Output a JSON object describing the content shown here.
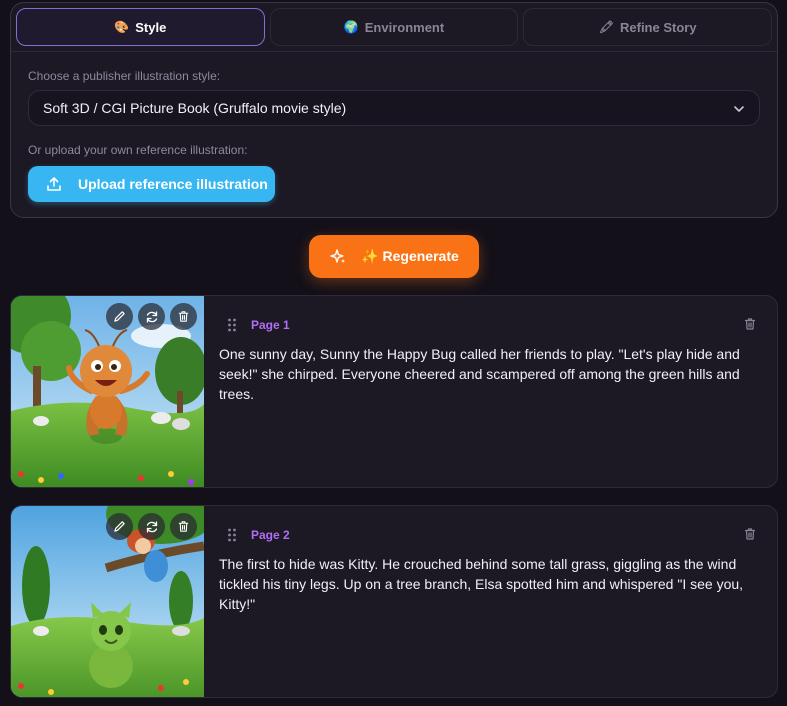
{
  "tabs": [
    {
      "label": "Style",
      "icon": "palette-icon",
      "emoji": "🎨",
      "active": true
    },
    {
      "label": "Environment",
      "icon": "globe-icon",
      "emoji": "🌍",
      "active": false
    },
    {
      "label": "Refine Story",
      "icon": "pencil-icon",
      "emoji": "🖍",
      "active": false
    }
  ],
  "style_panel": {
    "style_label": "Choose a publisher illustration style:",
    "selected_style": "Soft 3D / CGI Picture Book (Gruffalo movie style)",
    "upload_label": "Or upload your own reference illustration:",
    "upload_button": "Upload reference illustration"
  },
  "regenerate_button": "✨ Regenerate",
  "colors": {
    "accent_purple": "#b06ef5",
    "upload_blue": "#38b6f2",
    "regenerate_orange": "#f97316",
    "background": "#131019"
  },
  "pages": [
    {
      "label": "Page 1",
      "text": "One sunny day, Sunny the Happy Bug called her friends to play. \"Let's play hide and seek!\" she chirped. Everyone cheered and scampered off among the green hills and trees."
    },
    {
      "label": "Page 2",
      "text": "The first to hide was Kitty. He crouched behind some tall grass, giggling as the wind tickled his tiny legs. Up on a tree branch, Elsa spotted him and whispered \"I see you, Kitty!\""
    }
  ]
}
